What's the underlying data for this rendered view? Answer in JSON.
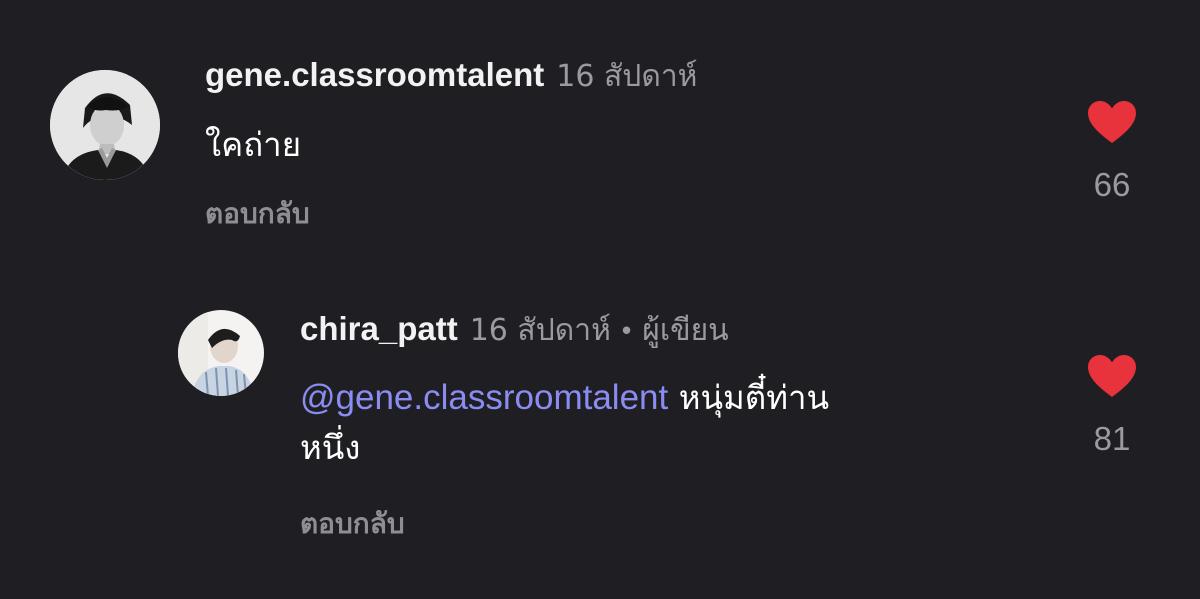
{
  "comments": [
    {
      "username": "gene.classroomtalent",
      "timestamp": "16 สัปดาห์",
      "text": "ใคถ่าย",
      "reply_label": "ตอบกลับ",
      "likes": "66",
      "avatar_icon": "avatar-photo"
    },
    {
      "username": "chira_patt",
      "timestamp": "16 สัปดาห์",
      "separator": "•",
      "author_tag": "ผู้เขียน",
      "mention": "@gene.classroomtalent",
      "text_line1": "หนุ่มตี๋ท่าน",
      "text_line2": "หนึ่ง",
      "reply_label": "ตอบกลับ",
      "likes": "81",
      "avatar_icon": "avatar-photo"
    }
  ],
  "colors": {
    "background": "#1f1f23",
    "like_heart": "#e8323c",
    "mention": "#8a8cf2",
    "muted": "#9a9aa0"
  }
}
